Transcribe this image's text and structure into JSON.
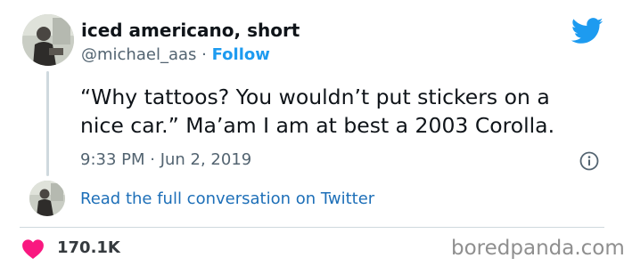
{
  "author": {
    "display_name": "iced americano, short",
    "handle": "@michael_aas",
    "separator": "·",
    "follow_label": "Follow"
  },
  "tweet": {
    "line1": "“Why tattoos? You wouldn’t put stickers on a",
    "line2": "nice car.” Ma’am I am at best a 2003 Corolla.",
    "timestamp": "9:33 PM · Jun 2, 2019"
  },
  "thread": {
    "read_full_label": "Read the full conversation on Twitter"
  },
  "engagement": {
    "likes": "170.1K"
  },
  "watermark": "boredpanda.com",
  "icons": {
    "brand": "twitter-bird-icon",
    "info": "info-icon",
    "like": "heart-icon"
  },
  "colors": {
    "twitter_blue": "#1d9bf0",
    "link_blue": "#1d6fb8",
    "heart_pink": "#f91880",
    "secondary_text": "#536471",
    "divider": "#cfd9de"
  }
}
